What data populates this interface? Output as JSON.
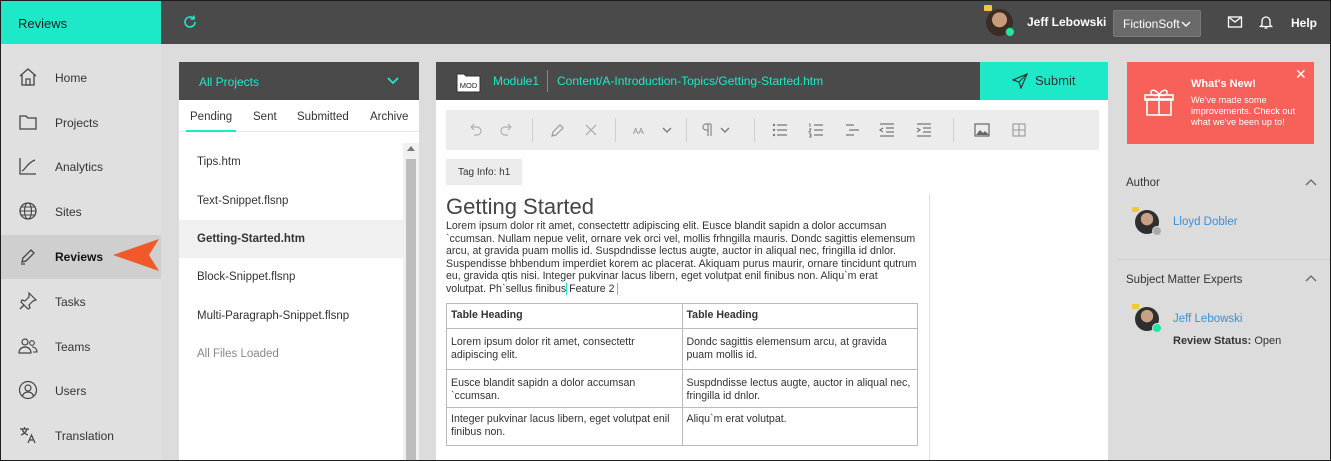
{
  "app": {
    "title": "Reviews"
  },
  "topbar": {
    "user_name": "Jeff Lebowski",
    "company": "FictionSoft",
    "help": "Help"
  },
  "nav": {
    "items": [
      {
        "label": "Home",
        "icon": "home-icon"
      },
      {
        "label": "Projects",
        "icon": "folder-icon"
      },
      {
        "label": "Analytics",
        "icon": "chart-icon"
      },
      {
        "label": "Sites",
        "icon": "globe-icon"
      },
      {
        "label": "Reviews",
        "icon": "pen-icon",
        "active": true
      },
      {
        "label": "Tasks",
        "icon": "pin-icon"
      },
      {
        "label": "Teams",
        "icon": "team-icon"
      },
      {
        "label": "Users",
        "icon": "user-icon"
      },
      {
        "label": "Translation",
        "icon": "translate-icon"
      }
    ]
  },
  "files": {
    "project_filter": "All Projects",
    "tabs": [
      "Pending",
      "Sent",
      "Submitted",
      "Archive"
    ],
    "active_tab": "Pending",
    "items": [
      "Tips.htm",
      "Text-Snippet.flsnp",
      "Getting-Started.htm",
      "Block-Snippet.flsnp",
      "Multi-Paragraph-Snippet.flsnp"
    ],
    "active_file": "Getting-Started.htm",
    "footer": "All Files Loaded"
  },
  "editor": {
    "mod_label": "MOD",
    "module": "Module1",
    "path": "Content/A-Introduction-Topics/Getting-Started.htm",
    "submit": "Submit",
    "tag_info_label": "Tag Info:",
    "tag_info_value": "h1",
    "doc": {
      "heading": "Getting Started",
      "paragraph": "Lorem ipsum dolor rit amet, consectettr adipiscing elit. Eusce blandit sapidn a dolor accumsan `ccumsan. Nullam nepue velit, ornare vek orci vel, mollis frhngilla mauris. Dondc sagittis elemensum arcu, at gravida puam mollis id. Suspdndisse lectus augte, auctor in aliqual nec, fringilla id dnlor. Suspendisse bhbendum imperdiet korem ac placerat. Akiquam purus maurir, ornare tincidunt qutrum eu, gravida qtis nisi. Integer pukvinar lacus libern, eget volutpat enil finibus non. Aliqu`m erat volutpat. Ph`sellus finibus",
      "feature": "Feature 2",
      "table": {
        "headers": [
          "Table Heading",
          "Table Heading"
        ],
        "rows": [
          [
            "Lorem ipsum dolor rit amet, consectettr adipiscing elit.",
            "Dondc sagittis elemensum arcu, at gravida puam mollis id."
          ],
          [
            "Eusce blandit sapidn a dolor accumsan `ccumsan.",
            "Suspdndisse lectus augte, auctor in aliqual nec, fringilla id dnlor."
          ],
          [
            "Integer pukvinar lacus libern, eget volutpat enil finibus non.",
            "Aliqu`m erat volutpat."
          ]
        ]
      }
    }
  },
  "whats_new": {
    "title": "What's New!",
    "body": "We've made some improvements. Check out what we've been up to!"
  },
  "author": {
    "section_title": "Author",
    "name": "Lloyd Dobler"
  },
  "sme": {
    "section_title": "Subject Matter Experts",
    "name": "Jeff Lebowski",
    "status_label": "Review Status:",
    "status_value": "Open"
  },
  "colors": {
    "accent": "#1de9c8",
    "header": "#4a4a4a",
    "whats_new": "#f8605a",
    "pointer": "#f05a28",
    "link": "#3a8fd6"
  }
}
